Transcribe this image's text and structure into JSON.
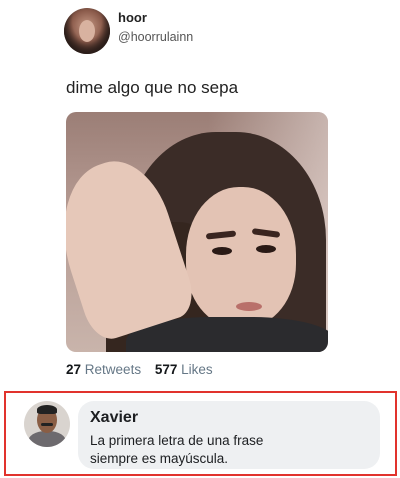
{
  "tweet": {
    "author": {
      "name": "hoor",
      "handle": "@hoorrulainn"
    },
    "text": "dime algo que no sepa",
    "stats": {
      "retweets_count": "27",
      "retweets_label": "Retweets",
      "likes_count": "577",
      "likes_label": "Likes"
    }
  },
  "reply": {
    "author": "Xavier",
    "line1": "La primera letra de una frase",
    "line2": "siempre es mayúscula.",
    "highlight_color": "#e1332d"
  }
}
